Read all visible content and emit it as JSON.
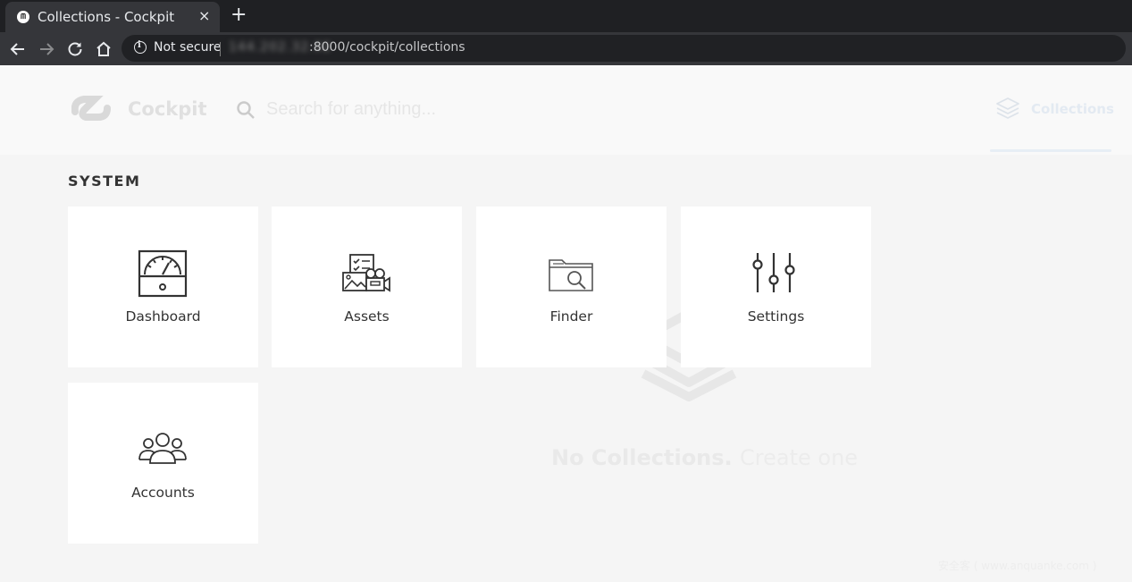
{
  "browser": {
    "tab_title": "Collections - Cockpit",
    "favicon_label": "cockpit",
    "close_glyph": "×",
    "new_tab_glyph": "+",
    "security_label": "Not secure",
    "url_host": "144.202.32.92",
    "url_path": ":8000/cockpit/collections"
  },
  "header": {
    "brand": "Cockpit",
    "search_placeholder": "Search for anything...",
    "nav_collections_label": "Collections"
  },
  "system": {
    "section_title": "SYSTEM",
    "tiles": [
      {
        "label": "Dashboard",
        "icon": "dashboard-gauge-icon"
      },
      {
        "label": "Assets",
        "icon": "assets-media-icon"
      },
      {
        "label": "Finder",
        "icon": "finder-folder-search-icon"
      },
      {
        "label": "Settings",
        "icon": "settings-sliders-icon"
      },
      {
        "label": "Accounts",
        "icon": "accounts-users-icon"
      }
    ]
  },
  "empty": {
    "message": "No Collections.",
    "create_link": "Create one"
  },
  "watermark": "安全客 ( www.anquanke.com )",
  "colors": {
    "chrome_dark": "#1f2023",
    "chrome_toolbar": "#35363a",
    "page_bg": "#f5f5f5",
    "tile_bg": "#ffffff",
    "text_dark": "#333333"
  }
}
